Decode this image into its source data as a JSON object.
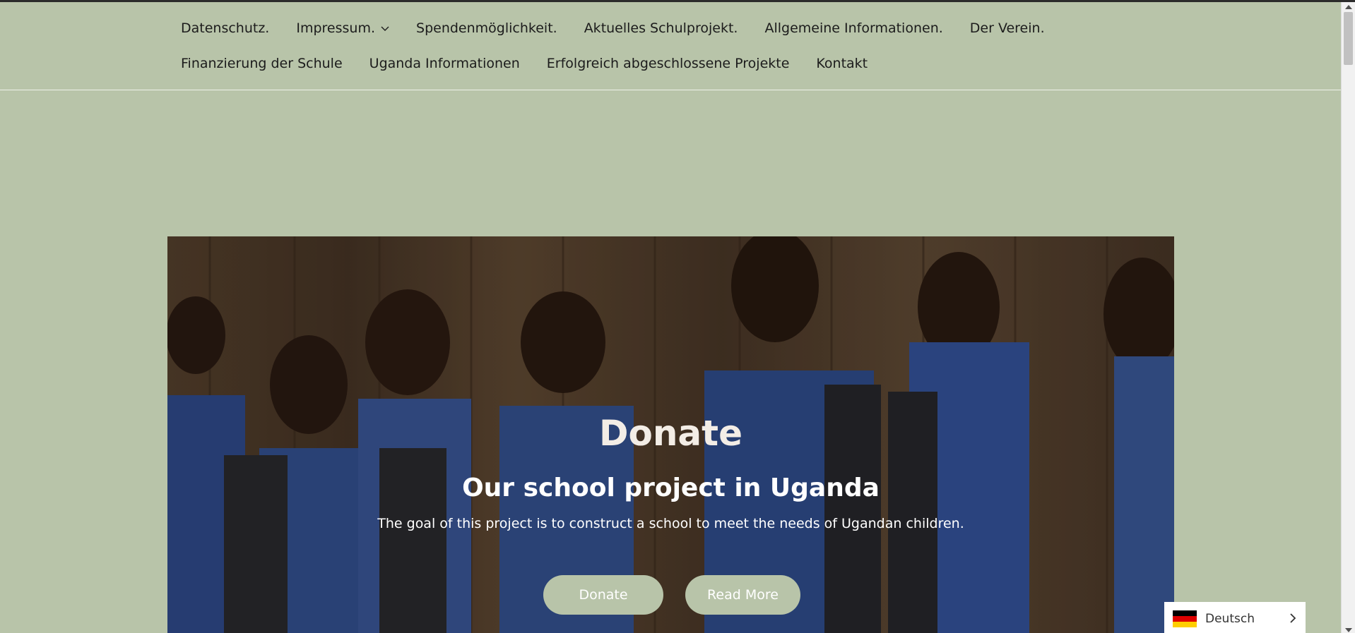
{
  "nav": {
    "row1": [
      {
        "label": "Datenschutz."
      },
      {
        "label": "Impressum."
      },
      {
        "label": "Spendenmöglichkeit."
      },
      {
        "label": "Aktuelles Schulprojekt."
      },
      {
        "label": "Allgemeine Informationen."
      },
      {
        "label": "Der Verein."
      }
    ],
    "row2": [
      {
        "label": "Finanzierung der Schule"
      },
      {
        "label": "Uganda Informationen"
      },
      {
        "label": "Erfolgreich abgeschlossene Projekte"
      },
      {
        "label": "Kontakt"
      }
    ]
  },
  "hero": {
    "title": "Donate",
    "subtitle": "Our school project in Uganda",
    "text": "The goal of this project is to construct a school to meet the needs of Ugandan children.",
    "donate_label": "Donate",
    "read_more_label": "Read More"
  },
  "language": {
    "selected": "Deutsch",
    "flag_icon": "germany-flag-icon"
  },
  "colors": {
    "background": "#b8c4a9",
    "button": "#b8c4a9"
  }
}
